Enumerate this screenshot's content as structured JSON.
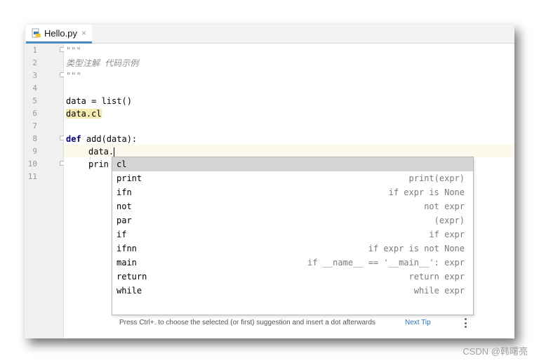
{
  "tab": {
    "title": "Hello.py",
    "close": "×"
  },
  "line_numbers": [
    "1",
    "2",
    "3",
    "4",
    "5",
    "6",
    "7",
    "8",
    "9",
    "10",
    "11"
  ],
  "code": {
    "l1": "\"\"\"",
    "l2": "类型注解 代码示例",
    "l3": "\"\"\"",
    "l5": "data = list()",
    "l6": "data.cl",
    "l8_kw": "def",
    "l8_rest": " add(data):",
    "l9": "data.",
    "l10": "prin"
  },
  "completion": {
    "items": [
      {
        "key": "cl",
        "tail": ""
      },
      {
        "key": "print",
        "tail": "print(expr)"
      },
      {
        "key": "ifn",
        "tail": "if expr is None"
      },
      {
        "key": "not",
        "tail": "not expr"
      },
      {
        "key": "par",
        "tail": "(expr)"
      },
      {
        "key": "if",
        "tail": "if expr"
      },
      {
        "key": "ifnn",
        "tail": "if expr is not None"
      },
      {
        "key": "main",
        "tail": "if __name__ == '__main__': expr"
      },
      {
        "key": "return",
        "tail": "return expr"
      },
      {
        "key": "while",
        "tail": "while expr"
      }
    ],
    "footer_text": "Press Ctrl+. to choose the selected (or first) suggestion and insert a dot afterwards",
    "next_tip": "Next Tip"
  },
  "watermark": "CSDN @韩曙亮",
  "colors": {
    "accent": "#4a88c7",
    "link": "#2a6fc9",
    "keyword": "#000080",
    "docstring": "#8c8c8c"
  }
}
